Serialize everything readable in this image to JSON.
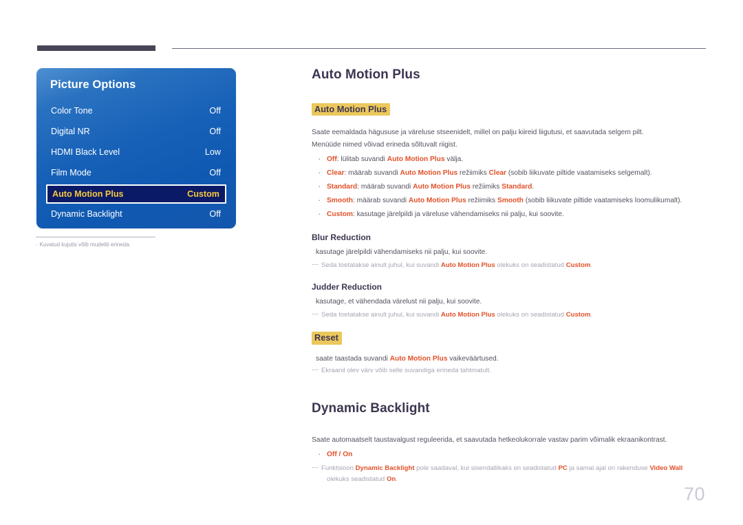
{
  "osd": {
    "title": "Picture Options",
    "rows": [
      {
        "label": "Color Tone",
        "value": "Off",
        "selected": false
      },
      {
        "label": "Digital NR",
        "value": "Off",
        "selected": false
      },
      {
        "label": "HDMI Black Level",
        "value": "Low",
        "selected": false
      },
      {
        "label": "Film Mode",
        "value": "Off",
        "selected": false
      },
      {
        "label": "Auto Motion Plus",
        "value": "Custom",
        "selected": true
      },
      {
        "label": "Dynamic Backlight",
        "value": "Off",
        "selected": false
      }
    ],
    "caption": "Kuvatud kujutis võib mudeliti erineda.",
    "caption_dash": "-"
  },
  "content": {
    "section1": {
      "title": "Auto Motion Plus",
      "badge": "Auto Motion Plus",
      "para1": "Saate eemaldada hägususe ja väreluse stseenidelt, millel on palju kiireid liigutusi, et saavutada selgem pilt.",
      "para2": "Menüüde nimed võivad erineda sõltuvalt riigist.",
      "bullets": [
        {
          "kw": "Off",
          "t1": ": lülitab suvandi ",
          "kw2": "Auto Motion Plus",
          "t2": " välja.",
          "kw3": "",
          "t3": ""
        },
        {
          "kw": "Clear",
          "t1": ": määrab suvandi ",
          "kw2": "Auto Motion Plus",
          "t2": " režiimiks ",
          "kw3": "Clear",
          "t3": " (sobib liikuvate piltide vaatamiseks selgemalt)."
        },
        {
          "kw": "Standard",
          "t1": ": määrab suvandi ",
          "kw2": "Auto Motion Plus",
          "t2": " režiimiks ",
          "kw3": "Standard",
          "t3": "."
        },
        {
          "kw": "Smooth",
          "t1": ": määrab suvandi ",
          "kw2": "Auto Motion Plus",
          "t2": " režiimiks ",
          "kw3": "Smooth",
          "t3": " (sobib liikuvate piltide vaatamiseks loomulikumalt)."
        },
        {
          "kw": "Custom",
          "t1": ": kasutage järelpildi ja väreluse vähendamiseks nii palju, kui soovite.",
          "kw2": "",
          "t2": "",
          "kw3": "",
          "t3": ""
        }
      ]
    },
    "blur": {
      "heading": "Blur Reduction",
      "body": "kasutage järelpildi vähendamiseks nii palju, kui soovite.",
      "note_a": "Seda toetatakse ainult juhul, kui suvandi ",
      "note_kw1": "Auto Motion Plus",
      "note_b": " olekuks on seadistatud ",
      "note_kw2": "Custom",
      "note_c": "."
    },
    "judder": {
      "heading": "Judder Reduction",
      "body": "kasutage, et vähendada värelust nii palju, kui soovite.",
      "note_a": "Seda toetatakse ainult juhul, kui suvandi ",
      "note_kw1": "Auto Motion Plus",
      "note_b": " olekuks on seadistatud ",
      "note_kw2": "Custom",
      "note_c": "."
    },
    "reset": {
      "badge": "Reset",
      "body_a": "saate taastada suvandi ",
      "body_kw": "Auto Motion Plus",
      "body_b": " vaikeväärtused.",
      "note": "Ekraanil olev värv võib selle suvandiga erineda tahtmatult."
    },
    "section2": {
      "title": "Dynamic Backlight",
      "para1": "Saate automaatselt taustavalgust reguleerida, et saavutada hetkeolukorrale vastav parim võimalik ekraanikontrast.",
      "bullet": "Off / On",
      "note_a": "Funktsioon ",
      "note_kw1": "Dynamic Backlight",
      "note_b": " pole saadaval, kui sisendallikaks on seadistatud ",
      "note_kw2": "PC",
      "note_c": " ja samal ajal on rakenduse ",
      "note_kw3": "Video Wall",
      "note_d": " olekuks seadistatud ",
      "note_kw4": "On",
      "note_e": "."
    }
  },
  "page_number": "70",
  "colors": {
    "accent_orange": "#e1512a",
    "badge_gold": "#ecc85c",
    "heading_purple": "#3d3550",
    "osd_blue": "#1761b8",
    "osd_selected": "#0b1a66",
    "osd_selected_text": "#f5c842"
  }
}
